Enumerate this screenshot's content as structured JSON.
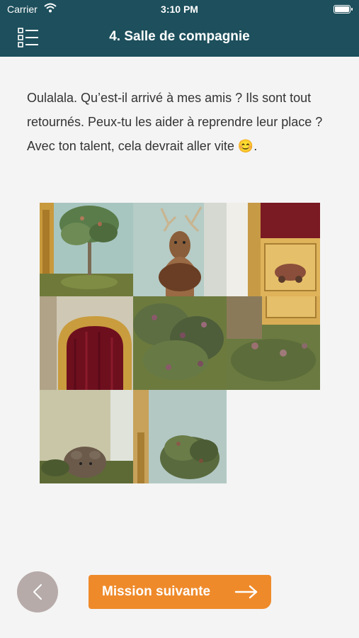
{
  "status_bar": {
    "carrier": "Carrier",
    "time": "3:10 PM"
  },
  "nav": {
    "title": "4. Salle de compagnie",
    "menu_icon": "list-menu-icon"
  },
  "intro_text": "Oulalala. Qu’est-il arrivé à mes amis ? Ils sont tout retournés. Peux-tu les aider à reprendre leur place ? Avec ton talent, cela devrait aller vite 😊.",
  "puzzle": {
    "tiles": [
      {
        "name": "tile-tree"
      },
      {
        "name": "tile-deer"
      },
      {
        "name": "tile-cabinet"
      },
      {
        "name": "tile-curtain-arch"
      },
      {
        "name": "tile-foliage"
      },
      {
        "name": "tile-cabinet-base"
      },
      {
        "name": "tile-bear"
      },
      {
        "name": "tile-plant"
      }
    ],
    "empty_slot": 8
  },
  "footer": {
    "back_icon": "chevron-left-icon",
    "next_label": "Mission suivante",
    "next_icon": "arrow-right-icon",
    "colors": {
      "accent": "#ef8a2a",
      "back": "#b7abaa",
      "header": "#1d4f5c"
    }
  }
}
